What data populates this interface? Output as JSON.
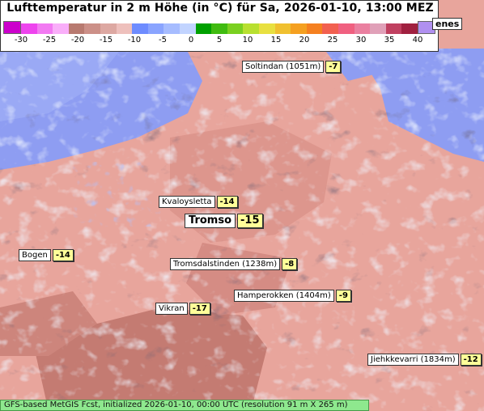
{
  "map": {
    "title": "Lufttemperatur in 2 m Höhe (in °C) für Sa, 2026-01-10, 13:00 MEZ",
    "legend": {
      "ticks": [
        "-30",
        "-25",
        "-20",
        "-15",
        "-10",
        "-5",
        "0",
        "5",
        "10",
        "15",
        "20",
        "25",
        "30",
        "35",
        "40"
      ],
      "colors": [
        "#cc00cc",
        "#ee44ee",
        "#f27af2",
        "#f9aef9",
        "#b87a70",
        "#cc9088",
        "#dda8a2",
        "#eec0bc",
        "#6e8cff",
        "#8aa4ff",
        "#a6bcff",
        "#c2d4ff",
        "#00a000",
        "#40bb10",
        "#7ad020",
        "#b8e030",
        "#e8e040",
        "#f0c030",
        "#f5a020",
        "#f58020",
        "#f26050",
        "#f06080",
        "#ea80a0",
        "#e0a0b8",
        "#c04060",
        "#a02040",
        "#b090f0"
      ]
    },
    "partial_label": "enes",
    "labels": [
      {
        "name": "Soltindan (1051m)",
        "value": "-7"
      },
      {
        "name": "Kvaloysletta",
        "value": "-14"
      },
      {
        "name": "Tromso",
        "value": "-15"
      },
      {
        "name": "Bogen",
        "value": "-14"
      },
      {
        "name": "Tromsdalstinden (1238m)",
        "value": "-8"
      },
      {
        "name": "Hamperokken (1404m)",
        "value": "-9"
      },
      {
        "name": "Vikran",
        "value": "-17"
      },
      {
        "name": "Jiehkkevarri (1834m)",
        "value": "-12"
      }
    ],
    "footer": "GFS-based MetGIS Fcst, initialized 2026-01-10, 00:00 UTC  (resolution 91 m X 265 m)"
  }
}
